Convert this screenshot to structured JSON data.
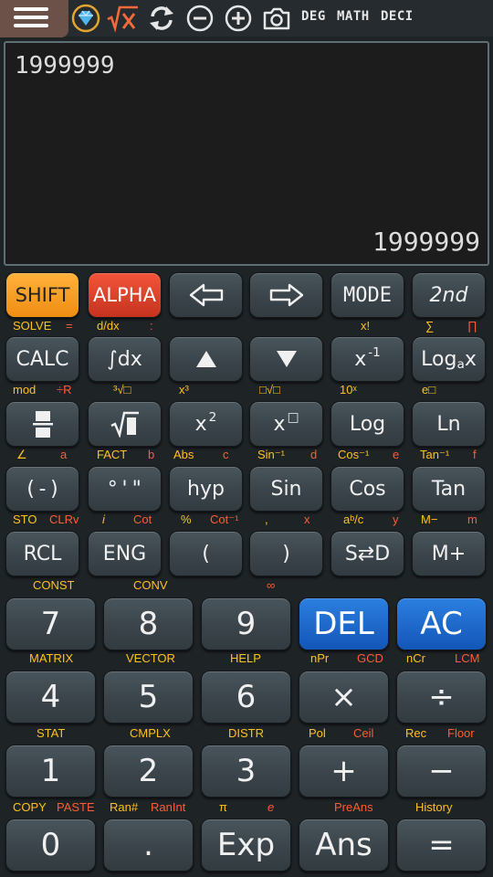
{
  "toolbar": {
    "deg": "DEG",
    "math": "MATH",
    "deci": "DECI"
  },
  "display": {
    "expression": "1999999",
    "result": "1999999"
  },
  "colors": {
    "shift": "#f7a126",
    "alpha": "#dc4430",
    "accent_blue": "#1c6acb",
    "label_yellow": "#ffc21d",
    "label_red": "#ff5b35"
  },
  "icons": [
    "menu-icon",
    "gem-icon",
    "sqrt-x-icon",
    "refresh-icon",
    "zoom-out-icon",
    "zoom-in-icon",
    "camera-icon",
    "left-arrow-icon",
    "right-arrow-icon",
    "up-triangle-icon",
    "down-triangle-icon",
    "fraction-icon",
    "sqrt-box-icon"
  ],
  "keys": {
    "shift": "SHIFT",
    "alpha": "ALPHA",
    "mode": "MODE",
    "second": "2nd",
    "calc": "CALC",
    "integral": "∫dx",
    "x_inv_base": "x",
    "x_inv_sup": "-1",
    "log_a_pre": "Log",
    "log_a_sub": "a",
    "log_a_post": "x",
    "x2_base": "x",
    "x2_sup": "2",
    "xbox_base": "x",
    "xbox_sup": "□",
    "log": "Log",
    "ln": "Ln",
    "neg": "(-)",
    "dms": "°'\"",
    "hyp": "hyp",
    "sin": "Sin",
    "cos": "Cos",
    "tan": "Tan",
    "rcl": "RCL",
    "eng": "ENG",
    "lparen": "(",
    "rparen": ")",
    "sd": "S⇄D",
    "mplus": "M+",
    "n7": "7",
    "n8": "8",
    "n9": "9",
    "del": "DEL",
    "ac": "AC",
    "n4": "4",
    "n5": "5",
    "n6": "6",
    "mul": "×",
    "div": "÷",
    "n1": "1",
    "n2": "2",
    "n3": "3",
    "plus": "+",
    "minus": "−",
    "n0": "0",
    "dot": ".",
    "exp": "Exp",
    "ans": "Ans",
    "equals": "="
  },
  "labels": {
    "solve": "SOLVE",
    "eq": "=",
    "ddx": "d/dx",
    "colon": ":",
    "fact_x": "x!",
    "sigma": "∑",
    "pi_prod": "∏",
    "mod": "mod",
    "div_r": "÷R",
    "cbrt": "³√□",
    "x3": "x³",
    "nroot": "□√□",
    "ten_x": "10ˣ",
    "e_x": "e□",
    "angle": "∠",
    "a": "a",
    "fact": "FACT",
    "b": "b",
    "abs": "Abs",
    "c": "c",
    "sin_inv": "Sin⁻¹",
    "d": "d",
    "cos_inv": "Cos⁻¹",
    "e_var": "e",
    "tan_inv": "Tan⁻¹",
    "f": "f",
    "sto": "STO",
    "clrv": "CLRv",
    "i": "i",
    "cot": "Cot",
    "percent": "%",
    "cot_inv": "Cot⁻¹",
    "comma": ",",
    "x_var": "x",
    "abc": "aᵇ/c",
    "y_var": "y",
    "m_minus": "M−",
    "m_var": "m",
    "const": "CONST",
    "conv": "CONV",
    "inf": "∞",
    "matrix": "MATRIX",
    "vector": "VECTOR",
    "help": "HELP",
    "npr": "nPr",
    "gcd": "GCD",
    "ncr": "nCr",
    "lcm": "LCM",
    "stat": "STAT",
    "cmplx": "CMPLX",
    "distr": "DISTR",
    "pol": "Pol",
    "ceil": "Ceil",
    "rec": "Rec",
    "floor": "Floor",
    "copy": "COPY",
    "paste": "PASTE",
    "ran": "Ran#",
    "ranint": "RanInt",
    "pi": "π",
    "e_const": "e",
    "preans": "PreAns",
    "history": "History"
  }
}
